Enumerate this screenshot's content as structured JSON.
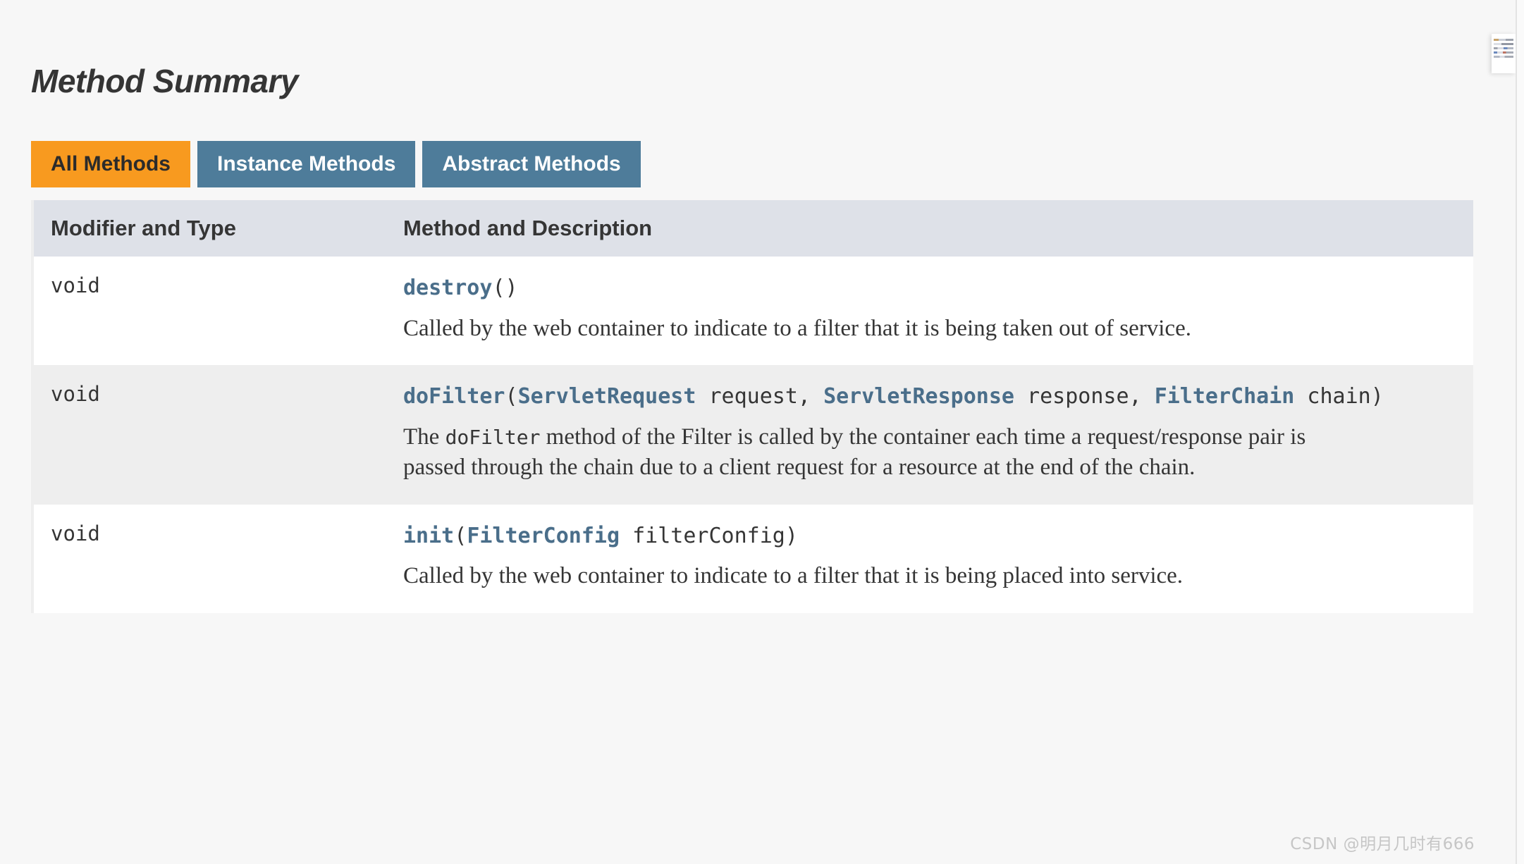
{
  "page": {
    "title": "Method Summary",
    "watermark": "CSDN @明月几时有666"
  },
  "tabs": [
    {
      "label": "All Methods",
      "state": "active"
    },
    {
      "label": "Instance Methods",
      "state": "inactive"
    },
    {
      "label": "Abstract Methods",
      "state": "inactive"
    }
  ],
  "table": {
    "columns": [
      "Modifier and Type",
      "Method and Description"
    ],
    "rows": [
      {
        "type": "void",
        "signature_parts": [
          {
            "text": "destroy",
            "kind": "link"
          },
          {
            "text": "()",
            "kind": "plain"
          }
        ],
        "description_parts": [
          {
            "text": "Called by the web container to indicate to a filter that it is being taken out of service.",
            "kind": "text"
          }
        ]
      },
      {
        "type": "void",
        "signature_parts": [
          {
            "text": "doFilter",
            "kind": "link"
          },
          {
            "text": "(",
            "kind": "plain"
          },
          {
            "text": "ServletRequest",
            "kind": "link"
          },
          {
            "text": " request, ",
            "kind": "plain"
          },
          {
            "text": "ServletResponse",
            "kind": "link"
          },
          {
            "text": " response, ",
            "kind": "plain"
          },
          {
            "text": "FilterChain",
            "kind": "link"
          },
          {
            "text": " chain)",
            "kind": "plain"
          }
        ],
        "description_parts": [
          {
            "text": "The ",
            "kind": "text"
          },
          {
            "text": "doFilter",
            "kind": "code"
          },
          {
            "text": " method of the Filter is called by the container each time a request/response pair is passed through the chain due to a client request for a resource at the end of the chain.",
            "kind": "text"
          }
        ]
      },
      {
        "type": "void",
        "signature_parts": [
          {
            "text": "init",
            "kind": "link"
          },
          {
            "text": "(",
            "kind": "plain"
          },
          {
            "text": "FilterConfig",
            "kind": "link"
          },
          {
            "text": " filterConfig)",
            "kind": "plain"
          }
        ],
        "description_parts": [
          {
            "text": "Called by the web container to indicate to a filter that it is being placed into service.",
            "kind": "text"
          }
        ]
      }
    ]
  },
  "colors": {
    "tab_active": "#f89a1f",
    "tab_inactive": "#4e7c9a",
    "header_row": "#dee1e8",
    "link": "#4a6e8a",
    "row_alt": "#eeeeee",
    "page_bg": "#f7f7f7"
  }
}
